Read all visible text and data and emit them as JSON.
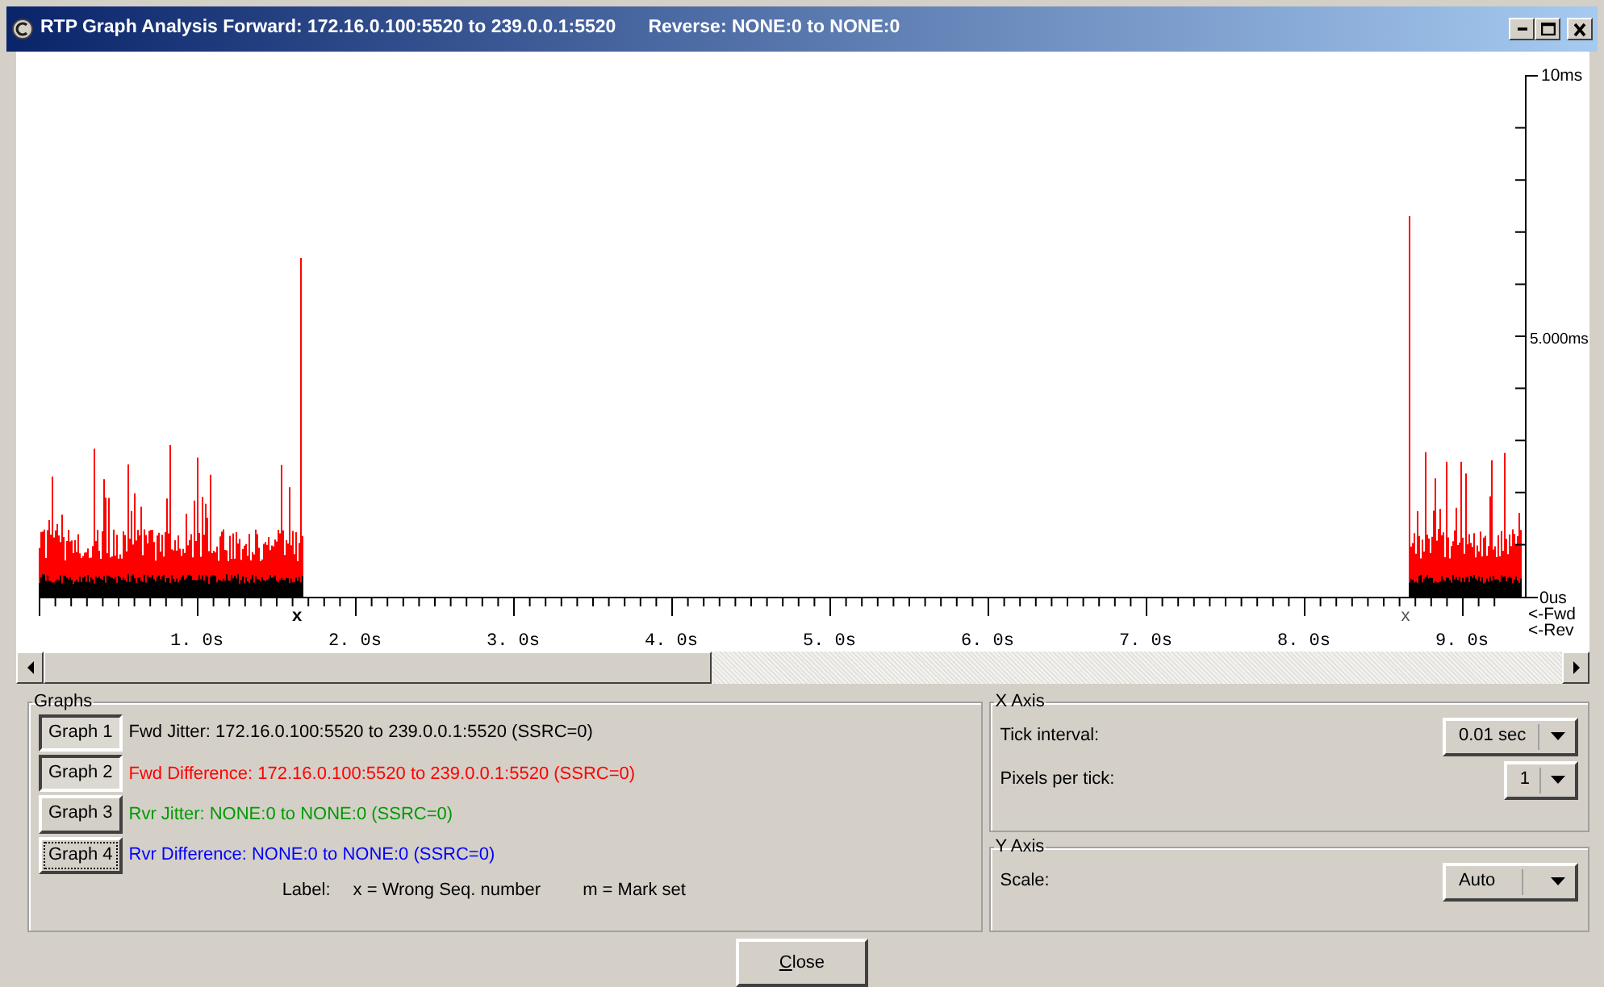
{
  "window": {
    "title": "RTP Graph Analysis Forward: 172.16.0.100:5520 to 239.0.0.1:5520",
    "title_reverse": "Reverse: NONE:0 to NONE:0"
  },
  "graph": {
    "y_labels": [
      "10ms",
      "5.000ms",
      "0us"
    ],
    "x_labels": [
      "1. 0s",
      "2. 0s",
      "3. 0s",
      "4. 0s",
      "5. 0s",
      "6. 0s",
      "7. 0s",
      "8. 0s",
      "9. 0s"
    ],
    "series_labels": [
      "<-Fwd",
      "<-Rev"
    ],
    "sequence_marks": [
      "x",
      "x"
    ]
  },
  "graphs_panel": {
    "title": "Graphs",
    "graphs": [
      {
        "button": "Graph 1",
        "label": "Fwd Jitter: 172.16.0.100:5520 to 239.0.0.1:5520 (SSRC=0)",
        "color": "#000000",
        "selected": true,
        "focused": false
      },
      {
        "button": "Graph 2",
        "label": "Fwd Difference: 172.16.0.100:5520 to 239.0.0.1:5520 (SSRC=0)",
        "color": "#ff0000",
        "selected": true,
        "focused": false
      },
      {
        "button": "Graph 3",
        "label": "Rvr Jitter: NONE:0 to NONE:0 (SSRC=0)",
        "color": "#009a00",
        "selected": false,
        "focused": false
      },
      {
        "button": "Graph 4",
        "label": "Rvr Difference: NONE:0 to NONE:0 (SSRC=0)",
        "color": "#0000ff",
        "selected": false,
        "focused": true
      }
    ],
    "legend": [
      "Label:",
      "x = Wrong Seq. number",
      "m = Mark set"
    ]
  },
  "x_axis": {
    "title": "X Axis",
    "settings": [
      {
        "label": "Tick interval:",
        "value": "0.01 sec"
      },
      {
        "label": "Pixels per tick:",
        "value": "1"
      }
    ]
  },
  "y_axis": {
    "title": "Y Axis",
    "settings": [
      {
        "label": "Scale:",
        "value": "Auto"
      }
    ]
  },
  "close_button": "Close"
}
